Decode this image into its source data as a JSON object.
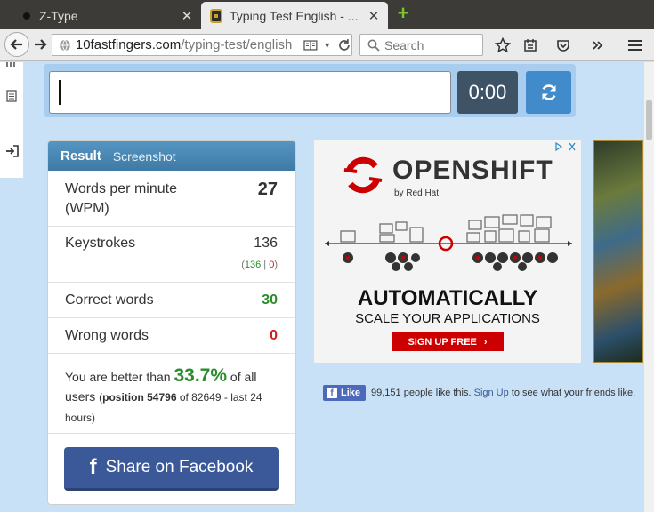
{
  "tabs": [
    {
      "title": "Z-Type",
      "close": "✕"
    },
    {
      "title": "Typing Test English - ...",
      "close": "✕"
    }
  ],
  "newtab": "+",
  "nav": {
    "url_host": "10fastfingers.com",
    "url_path": "/typing-test/english",
    "search_placeholder": "Search"
  },
  "typing": {
    "input_value": "",
    "timer": "0:00"
  },
  "result": {
    "title": "Result",
    "screenshot_tab": "Screenshot",
    "wpm_label": "Words per minute (WPM)",
    "wpm_value": "27",
    "keystrokes_label": "Keystrokes",
    "keystrokes_value": "136",
    "keystrokes_correct": "136",
    "keystrokes_sep": "|",
    "keystrokes_wrong": "0",
    "correct_label": "Correct words",
    "correct_value": "30",
    "wrong_label": "Wrong words",
    "wrong_value": "0",
    "better_prefix": "You are better than",
    "better_pct": "33.7%",
    "better_suffix": "of all users",
    "position_label": "position 54796",
    "position_rest": "of 82649 - last 24 hours",
    "share_button": "Share on Facebook"
  },
  "ad": {
    "brand": "OPENSHIFT",
    "by": "by Red Hat",
    "headline": "AUTOMATICALLY",
    "subline": "SCALE YOUR APPLICATIONS",
    "cta": "SIGN UP FREE"
  },
  "fb_like": {
    "button": "Like",
    "count_text": "99,151 people like this.",
    "signup": "Sign Up",
    "rest": "to see what your friends like."
  },
  "colors": {
    "page_bg": "#c9e1f7",
    "timer_bg": "#3f5367",
    "reset_bg": "#428bca",
    "panel_header": "#4d8ab5",
    "good": "#2a8d2a",
    "bad": "#d21c1c",
    "facebook": "#3b5998",
    "ad_red": "#cc0000"
  }
}
